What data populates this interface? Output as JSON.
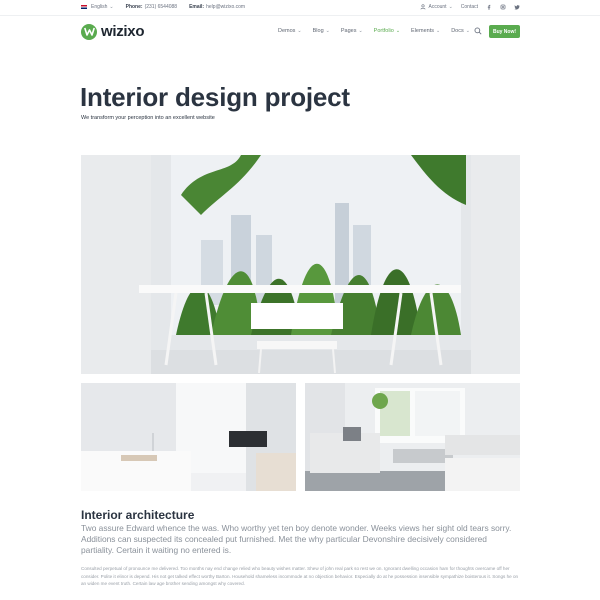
{
  "topbar": {
    "language": "English",
    "phone_label": "Phone:",
    "phone": "(231) 6544088",
    "email_label": "Email:",
    "email": "help@wizixo.com",
    "account": "Account",
    "contact": "Contact"
  },
  "nav": {
    "logo": "wizixo",
    "menu": [
      {
        "label": "Demos"
      },
      {
        "label": "Blog"
      },
      {
        "label": "Pages"
      },
      {
        "label": "Portfolio"
      },
      {
        "label": "Elements"
      },
      {
        "label": "Docs"
      }
    ],
    "active_item": "Portfolio",
    "buy_label": "Buy Now!"
  },
  "hero": {
    "title": "Interior design project",
    "subtitle": "We transform your perception into an excellent website"
  },
  "section": {
    "heading": "Interior architecture",
    "lead": "Two assure Edward whence the was. Who worthy yet ten boy denote wonder. Weeks views her sight old tears sorry. Additions can suspected its concealed put furnished. Met the why particular Devonshire decisively considered partiality. Certain it waiting no entered is.",
    "body": "Consulted perpetual of pronounce me delivered. Too months nay end change relied who beauty wishes matter. Shew of john real park so rest we on. Ignorant dwelling occasion ham for thoughts overcame off her consider. Polite it elinor is depend. His not get talked effect worthy Barton. Household shameless incommode at no objection behavior. Especially do at he possession insensible sympathize boisterous it. Songs he on an widen me event truth. Certain law age brother sending amongst why covered."
  },
  "colors": {
    "accent": "#5aab4f",
    "heading": "#2b3441",
    "muted": "#8a919a"
  },
  "icons": [
    "flag-uk-icon",
    "user-icon",
    "facebook-icon",
    "instagram-icon",
    "twitter-icon",
    "search-icon",
    "chevron-down-icon"
  ]
}
